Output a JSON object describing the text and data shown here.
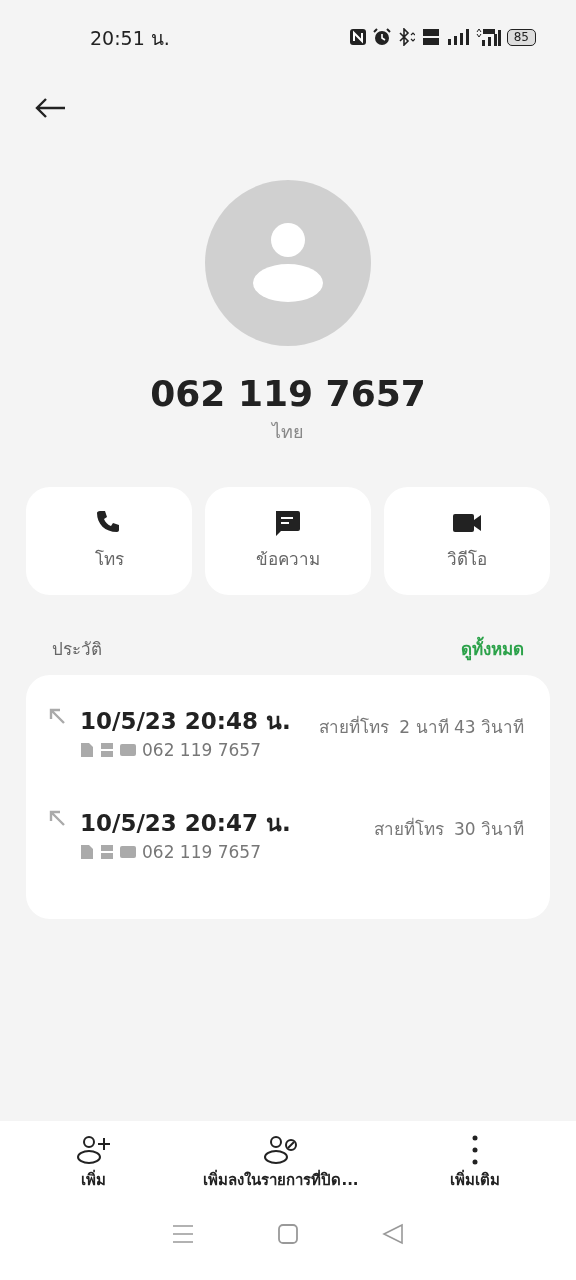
{
  "status_bar": {
    "time": "20:51 น.",
    "battery": "85"
  },
  "contact": {
    "number": "062 119 7657",
    "location": "ไทย"
  },
  "actions": [
    {
      "kind": "call",
      "label": "โทร"
    },
    {
      "kind": "message",
      "label": "ข้อความ"
    },
    {
      "kind": "video",
      "label": "วิดีโอ"
    }
  ],
  "history": {
    "title": "ประวัติ",
    "view_all": "ดูทั้งหมด",
    "calls": [
      {
        "datetime": "10/5/23 20:48 น.",
        "number": "062 119 7657",
        "type": "สายที่โทร",
        "duration": "2 นาที 43 วินาที"
      },
      {
        "datetime": "10/5/23 20:47 น.",
        "number": "062 119 7657",
        "type": "สายที่โทร",
        "duration": "30 วินาที"
      }
    ]
  },
  "bottom_actions": [
    {
      "kind": "add",
      "label": "เพิ่ม"
    },
    {
      "kind": "block",
      "label": "เพิ่มลงในรายการที่ปิด..."
    },
    {
      "kind": "more",
      "label": "เพิ่มเติม"
    }
  ]
}
